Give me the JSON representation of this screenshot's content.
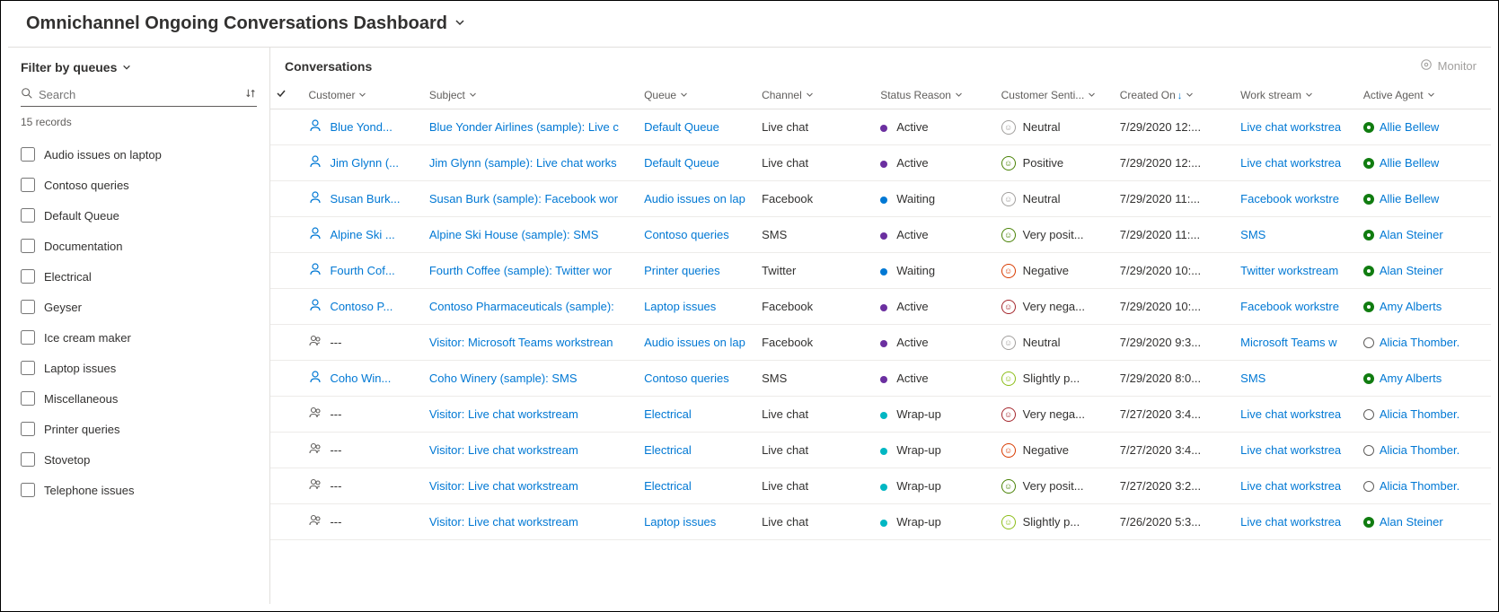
{
  "title": "Omnichannel Ongoing Conversations Dashboard",
  "sidebar": {
    "filterLabel": "Filter by queues",
    "searchPlaceholder": "Search",
    "recordCount": "15 records",
    "queues": [
      "Audio issues on laptop",
      "Contoso queries",
      "Default Queue",
      "Documentation",
      "Electrical",
      "Geyser",
      "Ice cream maker",
      "Laptop issues",
      "Miscellaneous",
      "Printer queries",
      "Stovetop",
      "Telephone issues"
    ]
  },
  "main": {
    "heading": "Conversations",
    "monitorLabel": "Monitor",
    "columns": [
      "Customer",
      "Subject",
      "Queue",
      "Channel",
      "Status Reason",
      "Customer Senti...",
      "Created On",
      "Work stream",
      "Active Agent"
    ],
    "rows": [
      {
        "iconType": "person",
        "customer": "Blue Yond...",
        "subject": "Blue Yonder Airlines (sample): Live c",
        "queue": "Default Queue",
        "queueLink": true,
        "channel": "Live chat",
        "statusColor": "#6b2fa0",
        "status": "Active",
        "sentiment": "Neutral",
        "sentiColor": "#a19f9d",
        "created": "7/29/2020 12:...",
        "workstream": "Live chat workstrea",
        "agent": "Allie Bellew",
        "agentStatus": "#107c10",
        "agentFilled": true
      },
      {
        "iconType": "person",
        "customer": "Jim Glynn (...",
        "subject": "Jim Glynn (sample): Live chat works",
        "queue": "Default Queue",
        "queueLink": true,
        "channel": "Live chat",
        "statusColor": "#6b2fa0",
        "status": "Active",
        "sentiment": "Positive",
        "sentiColor": "#498205",
        "created": "7/29/2020 12:...",
        "workstream": "Live chat workstrea",
        "agent": "Allie Bellew",
        "agentStatus": "#107c10",
        "agentFilled": true
      },
      {
        "iconType": "person",
        "customer": "Susan Burk...",
        "subject": "Susan Burk (sample): Facebook wor",
        "queue": "Audio issues on lap",
        "queueLink": true,
        "channel": "Facebook",
        "statusColor": "#0078d4",
        "status": "Waiting",
        "sentiment": "Neutral",
        "sentiColor": "#a19f9d",
        "created": "7/29/2020 11:...",
        "workstream": "Facebook workstre",
        "agent": "Allie Bellew",
        "agentStatus": "#107c10",
        "agentFilled": true
      },
      {
        "iconType": "person",
        "customer": "Alpine Ski ...",
        "subject": "Alpine Ski House (sample): SMS",
        "queue": "Contoso queries",
        "queueLink": true,
        "channel": "SMS",
        "statusColor": "#6b2fa0",
        "status": "Active",
        "sentiment": "Very posit...",
        "sentiColor": "#498205",
        "created": "7/29/2020 11:...",
        "workstream": "SMS",
        "agent": "Alan Steiner",
        "agentStatus": "#107c10",
        "agentFilled": true
      },
      {
        "iconType": "person",
        "customer": "Fourth Cof...",
        "subject": "Fourth Coffee (sample): Twitter wor",
        "queue": "Printer queries",
        "queueLink": true,
        "channel": "Twitter",
        "statusColor": "#0078d4",
        "status": "Waiting",
        "sentiment": "Negative",
        "sentiColor": "#d83b01",
        "created": "7/29/2020 10:...",
        "workstream": "Twitter workstream",
        "agent": "Alan Steiner",
        "agentStatus": "#107c10",
        "agentFilled": true
      },
      {
        "iconType": "person",
        "customer": "Contoso P...",
        "subject": "Contoso Pharmaceuticals (sample):",
        "queue": "Laptop issues",
        "queueLink": true,
        "channel": "Facebook",
        "statusColor": "#6b2fa0",
        "status": "Active",
        "sentiment": "Very nega...",
        "sentiColor": "#a4262c",
        "created": "7/29/2020 10:...",
        "workstream": "Facebook workstre",
        "agent": "Amy Alberts",
        "agentStatus": "#107c10",
        "agentFilled": true
      },
      {
        "iconType": "group",
        "customer": "---",
        "subject": "Visitor: Microsoft Teams workstrean",
        "queue": "Audio issues on lap",
        "queueLink": true,
        "channel": "Facebook",
        "statusColor": "#6b2fa0",
        "status": "Active",
        "sentiment": "Neutral",
        "sentiColor": "#a19f9d",
        "created": "7/29/2020 9:3...",
        "workstream": "Microsoft Teams w",
        "agent": "Alicia Thomber.",
        "agentStatus": "transparent",
        "agentFilled": false
      },
      {
        "iconType": "person",
        "customer": "Coho Win...",
        "subject": "Coho Winery (sample): SMS",
        "queue": "Contoso queries",
        "queueLink": true,
        "channel": "SMS",
        "statusColor": "#6b2fa0",
        "status": "Active",
        "sentiment": "Slightly p...",
        "sentiColor": "#8cbd18",
        "created": "7/29/2020 8:0...",
        "workstream": "SMS",
        "agent": "Amy Alberts",
        "agentStatus": "#107c10",
        "agentFilled": true
      },
      {
        "iconType": "group",
        "customer": "---",
        "subject": "Visitor: Live chat workstream",
        "queue": "Electrical",
        "queueLink": true,
        "channel": "Live chat",
        "statusColor": "#00b7c3",
        "status": "Wrap-up",
        "sentiment": "Very nega...",
        "sentiColor": "#a4262c",
        "created": "7/27/2020 3:4...",
        "workstream": "Live chat workstrea",
        "agent": "Alicia Thomber.",
        "agentStatus": "transparent",
        "agentFilled": false
      },
      {
        "iconType": "group",
        "customer": "---",
        "subject": "Visitor: Live chat workstream",
        "queue": "Electrical",
        "queueLink": true,
        "channel": "Live chat",
        "statusColor": "#00b7c3",
        "status": "Wrap-up",
        "sentiment": "Negative",
        "sentiColor": "#d83b01",
        "created": "7/27/2020 3:4...",
        "workstream": "Live chat workstrea",
        "agent": "Alicia Thomber.",
        "agentStatus": "transparent",
        "agentFilled": false
      },
      {
        "iconType": "group",
        "customer": "---",
        "subject": "Visitor: Live chat workstream",
        "queue": "Electrical",
        "queueLink": true,
        "channel": "Live chat",
        "statusColor": "#00b7c3",
        "status": "Wrap-up",
        "sentiment": "Very posit...",
        "sentiColor": "#498205",
        "created": "7/27/2020 3:2...",
        "workstream": "Live chat workstrea",
        "agent": "Alicia Thomber.",
        "agentStatus": "transparent",
        "agentFilled": false
      },
      {
        "iconType": "group",
        "customer": "---",
        "subject": "Visitor: Live chat workstream",
        "queue": "Laptop issues",
        "queueLink": true,
        "channel": "Live chat",
        "statusColor": "#00b7c3",
        "status": "Wrap-up",
        "sentiment": "Slightly p...",
        "sentiColor": "#8cbd18",
        "created": "7/26/2020 5:3...",
        "workstream": "Live chat workstrea",
        "agent": "Alan Steiner",
        "agentStatus": "#107c10",
        "agentFilled": true
      }
    ]
  }
}
